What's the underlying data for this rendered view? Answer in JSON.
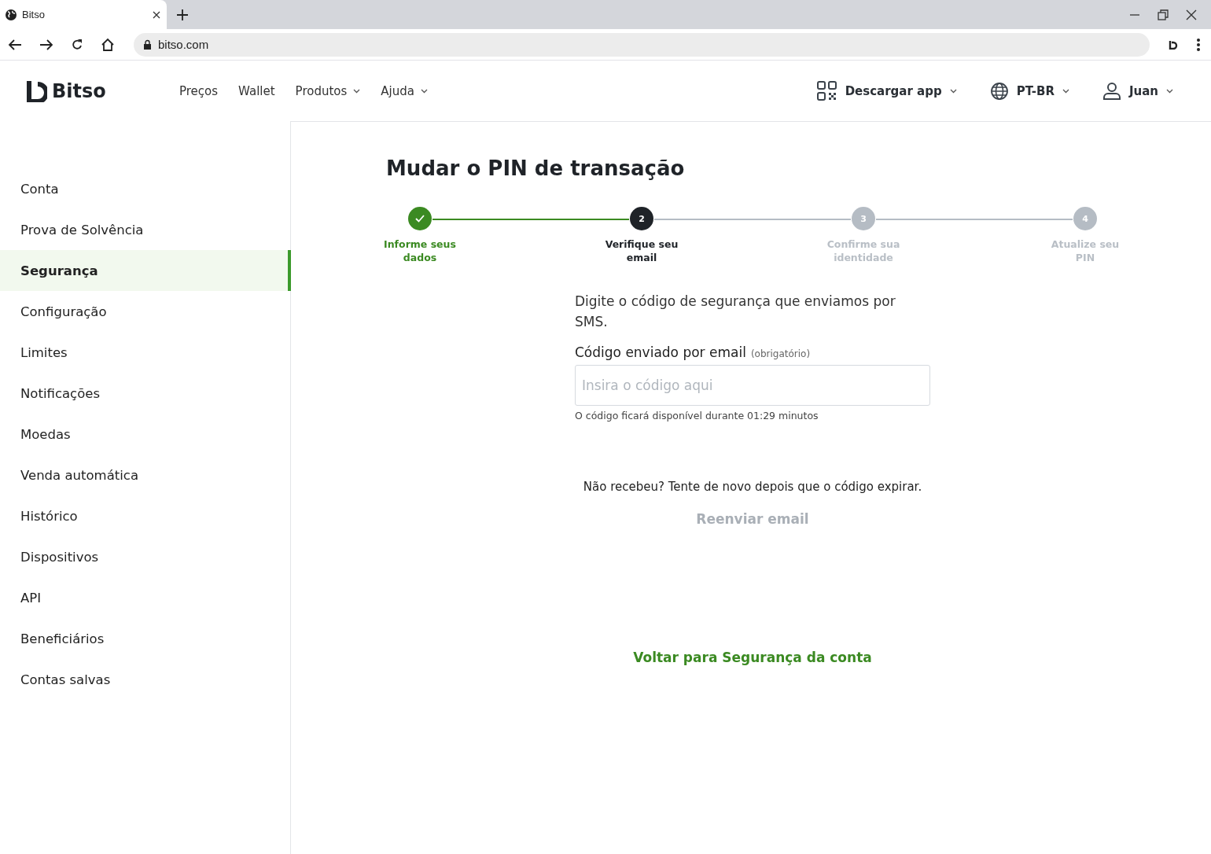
{
  "browser": {
    "tab_title": "Bitso",
    "url": "bitso.com"
  },
  "header": {
    "logo": "Bitso",
    "nav": [
      {
        "label": "Preços",
        "dropdown": false
      },
      {
        "label": "Wallet",
        "dropdown": false
      },
      {
        "label": "Produtos",
        "dropdown": true
      },
      {
        "label": "Ajuda",
        "dropdown": true
      }
    ],
    "download": "Descargar app",
    "language": "PT-BR",
    "user": "Juan"
  },
  "sidebar": {
    "items": [
      {
        "label": "Conta",
        "selected": false
      },
      {
        "label": "Prova de Solvência",
        "selected": false
      },
      {
        "label": "Segurança",
        "selected": true
      },
      {
        "label": "Configuração",
        "selected": false
      },
      {
        "label": "Limites",
        "selected": false
      },
      {
        "label": "Notificações",
        "selected": false
      },
      {
        "label": "Moedas",
        "selected": false
      },
      {
        "label": "Venda automática",
        "selected": false
      },
      {
        "label": "Histórico",
        "selected": false
      },
      {
        "label": "Dispositivos",
        "selected": false
      },
      {
        "label": "API",
        "selected": false
      },
      {
        "label": "Beneficiários",
        "selected": false
      },
      {
        "label": "Contas salvas",
        "selected": false
      }
    ]
  },
  "page": {
    "title": "Mudar o PIN de transação",
    "steps": [
      {
        "label": "Informe seus dados",
        "kind": "done"
      },
      {
        "number": "2",
        "label": "Verifique seu email",
        "kind": "current"
      },
      {
        "number": "3",
        "label": "Confirme sua identidade",
        "kind": "pending"
      },
      {
        "number": "4",
        "label": "Atualize seu PIN",
        "kind": "pending"
      }
    ],
    "instruction": "Digite o código de segurança que enviamos por SMS.",
    "field": {
      "label": "Código enviado por email",
      "required_note": "(obrigatório)",
      "placeholder": "Insira o código aqui",
      "hint": "O código ficará disponível durante 01:29 minutos"
    },
    "resend_note": "Não recebeu? Tente de novo depois que o código expirar.",
    "resend": {
      "label": "Reenviar email",
      "disabled": true
    },
    "back_link": "Voltar para Segurança da conta"
  }
}
